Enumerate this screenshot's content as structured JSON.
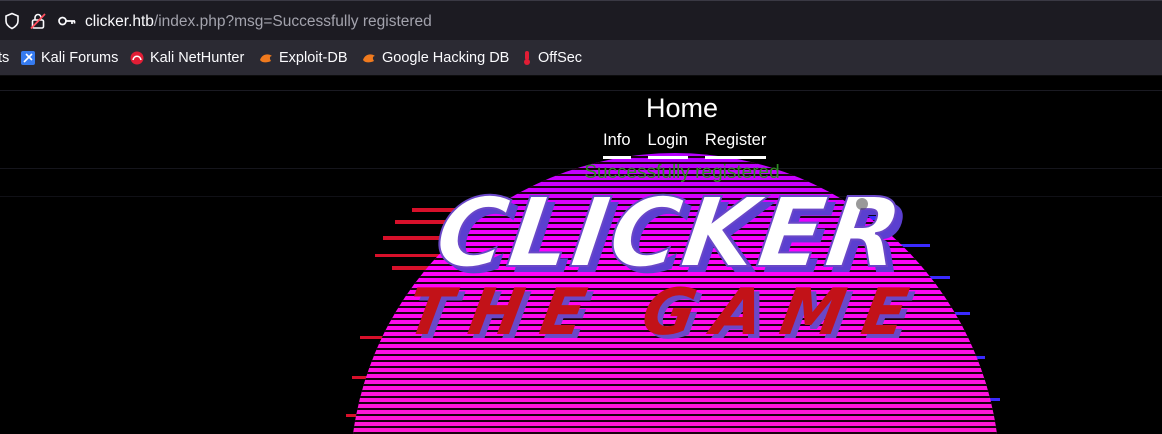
{
  "browser": {
    "url_host": "clicker.htb",
    "url_path": "/index.php?msg=Successfully registered",
    "bookmarks": [
      {
        "label": "ts",
        "icon": "bookmark-icon"
      },
      {
        "label": "Kali Forums",
        "icon": "kali-forums-icon"
      },
      {
        "label": "Kali NetHunter",
        "icon": "kali-nethunter-icon"
      },
      {
        "label": "Exploit-DB",
        "icon": "exploit-db-icon"
      },
      {
        "label": "Google Hacking DB",
        "icon": "ghdb-icon"
      },
      {
        "label": "OffSec",
        "icon": "offsec-icon"
      }
    ]
  },
  "page": {
    "title": "Home",
    "nav": [
      "Info",
      "Login",
      "Register"
    ],
    "message": "Successfully registered",
    "logo_text": "CLICKER THE GAME"
  },
  "colors": {
    "sun_pink": "#ff00ff",
    "sun_red": "#e0102a",
    "logo_fill": "#ffffff",
    "logo_shadow": "#6a48c8",
    "subtitle_red": "#c21218",
    "message_green": "#2e8b22"
  }
}
